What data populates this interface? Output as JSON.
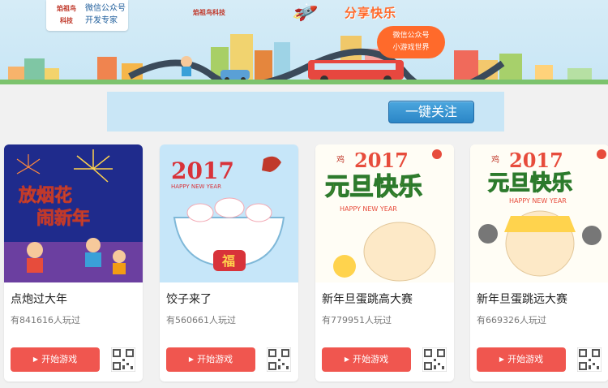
{
  "banner": {
    "logo_mark_line1": "焰祖鸟",
    "logo_mark_line2": "科技",
    "logo_line1": "微信公众号",
    "logo_line2": "开发专家",
    "brand_small": "焰祖鸟科技",
    "share_title": "分享快乐",
    "bubble_line1": "微信公众号",
    "bubble_line2": "小游戏世界"
  },
  "follow": {
    "button_label": "一键关注"
  },
  "colors": {
    "accent_red": "#f0564f",
    "follow_blue": "#2b86c6",
    "banner_bg": "#c8e6f5"
  },
  "games": [
    {
      "title": "点炮过大年",
      "players": "有841616人玩过",
      "start_label": "开始游戏",
      "art": {
        "headline_line1": "放烟花",
        "headline_line2": "闹新年"
      }
    },
    {
      "title": "饺子来了",
      "players": "有560661人玩过",
      "start_label": "开始游戏",
      "art": {
        "year": "2017",
        "greeting": "HAPPY NEW YEAR",
        "fu": "福"
      }
    },
    {
      "title": "新年旦蛋跳高大赛",
      "players": "有779951人玩过",
      "start_label": "开始游戏",
      "art": {
        "year": "2017",
        "headline": "元旦快乐",
        "greeting": "HAPPY NEW YEAR",
        "seal": "鸡"
      }
    },
    {
      "title": "新年旦蛋跳远大赛",
      "players": "有669326人玩过",
      "start_label": "开始游戏",
      "art": {
        "year": "2017",
        "headline": "元旦快乐",
        "greeting": "HAPPY NEW YEAR",
        "seal": "鸡"
      }
    }
  ]
}
